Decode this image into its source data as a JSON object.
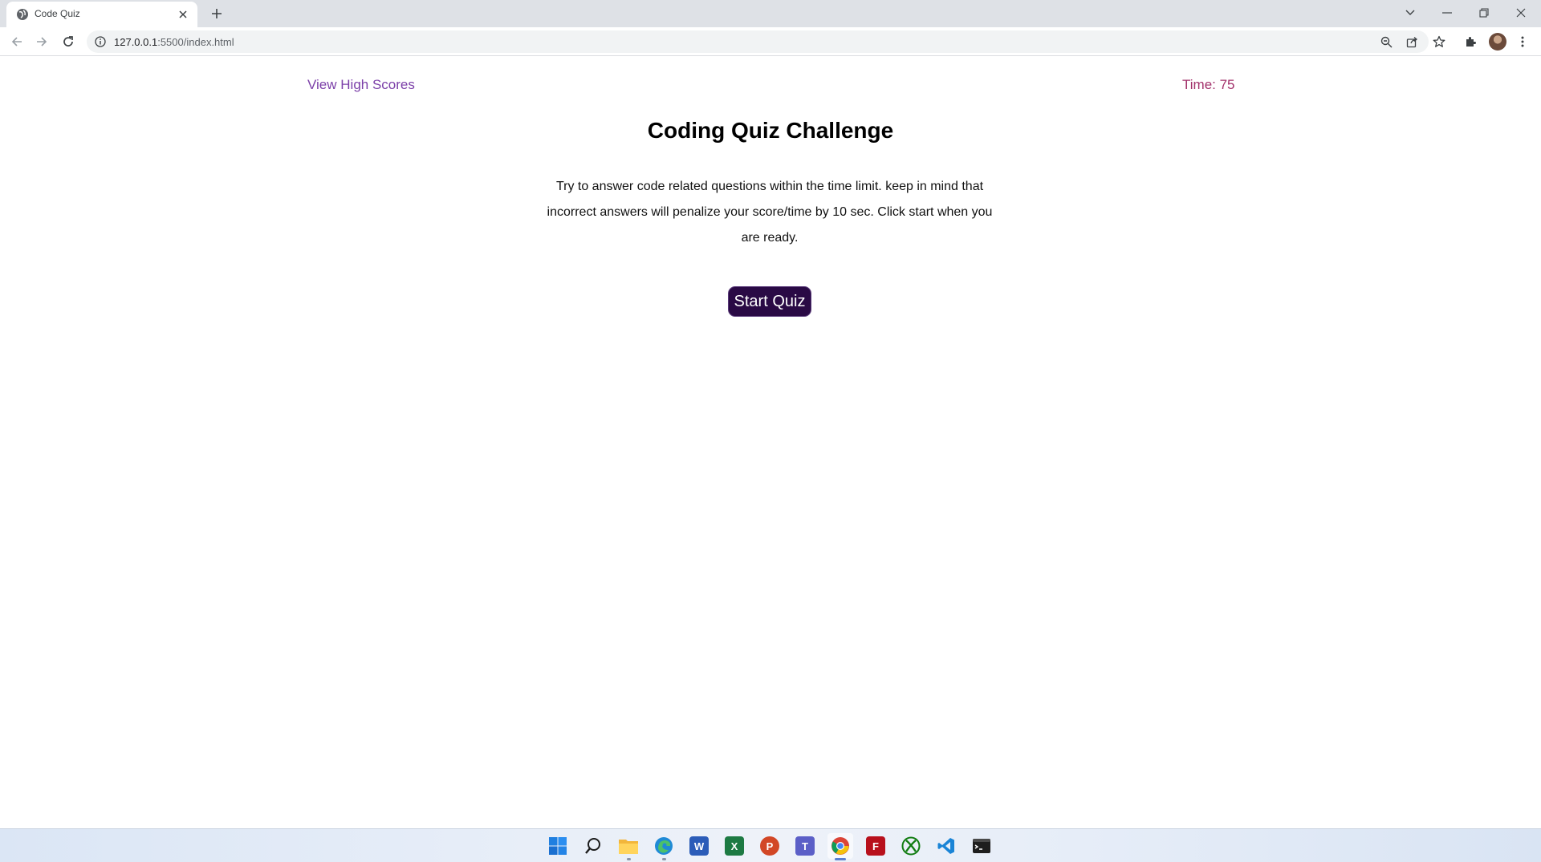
{
  "browser": {
    "tab_title": "Code Quiz",
    "url_host": "127.0.0.1",
    "url_rest": ":5500/index.html"
  },
  "page": {
    "high_scores_link": "View High Scores",
    "timer": "Time: 75",
    "title": "Coding Quiz Challenge",
    "description": "Try to answer code related questions within the time limit. keep in mind that incorrect answers will penalize your score/time by 10 sec. Click start when you are ready.",
    "start_button": "Start Quiz"
  },
  "colors": {
    "link": "#7b3fa8",
    "timer": "#a2306a",
    "button_bg": "#2a0a45"
  },
  "taskbar": {
    "apps": [
      "start-icon",
      "search-icon",
      "file-explorer-icon",
      "edge-icon",
      "word-icon",
      "excel-icon",
      "powerpoint-icon",
      "teams-icon",
      "chrome-icon",
      "filezilla-icon",
      "xbox-icon",
      "vscode-icon",
      "terminal-icon"
    ]
  }
}
